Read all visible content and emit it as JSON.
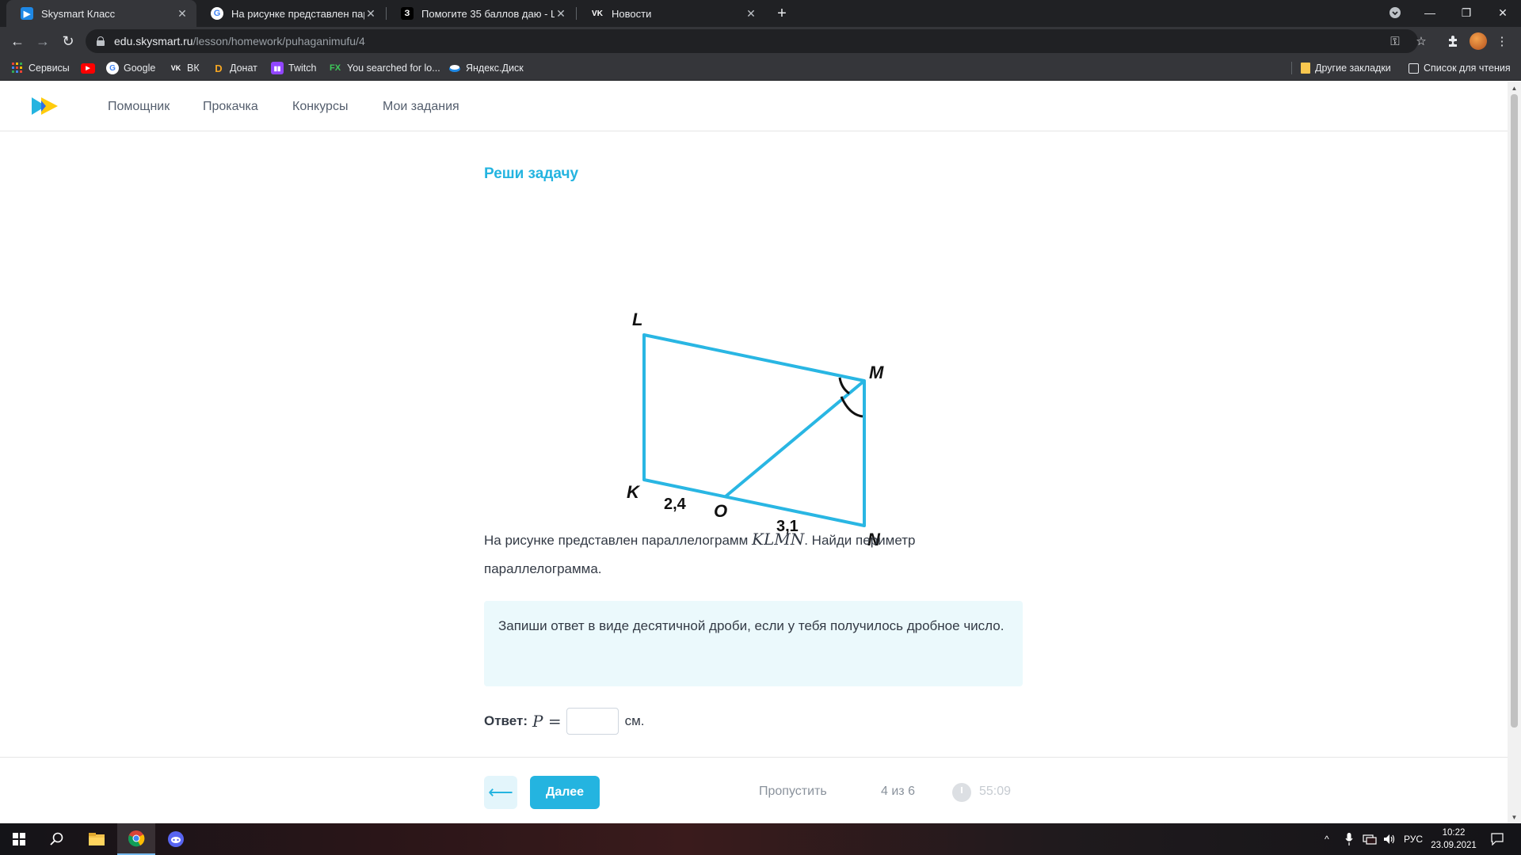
{
  "browser": {
    "tabs": [
      {
        "title": "Skysmart Класс",
        "active": true
      },
      {
        "title": "На рисунке представлен парал...",
        "active": false
      },
      {
        "title": "Помогите 35 баллов даю - Шко...",
        "active": false
      },
      {
        "title": "Новости",
        "active": false
      }
    ],
    "url_host": "edu.skysmart.ru",
    "url_path": "/lesson/homework/puhaganimufu/4",
    "bookmarks": [
      "Сервисы",
      "Google",
      "ВК",
      "Донат",
      "Twitch",
      "You searched for lo...",
      "Яндекс.Диск"
    ],
    "bookmarks_right": [
      "Другие закладки",
      "Список для чтения"
    ]
  },
  "site": {
    "nav": [
      "Помощник",
      "Прокачка",
      "Конкурсы",
      "Мои задания"
    ],
    "brand_color": "#24b4e0"
  },
  "task": {
    "title": "Реши задачу",
    "figure": {
      "vertices": {
        "L": "L",
        "M": "M",
        "K": "K",
        "O": "O",
        "N": "N"
      },
      "label_ko": "2,4",
      "label_on": "3,1"
    },
    "question_before": "На рисунке представлен параллелограмм ",
    "question_math": "KLMN",
    "question_after": ". Найди периметр параллелограмма.",
    "hint": "Запиши ответ в виде десятичной дроби, если у тебя получилось дробное число.",
    "answer_label": "Ответ:",
    "answer_math": "P =",
    "answer_value": "",
    "answer_unit": "см."
  },
  "footer": {
    "back_icon": "arrow-left-icon",
    "next_label": "Далее",
    "skip_label": "Пропустить",
    "counter": "4 из 6",
    "timer": "55:09"
  },
  "taskbar": {
    "lang": "РУС",
    "time": "10:22",
    "date": "23.09.2021"
  }
}
